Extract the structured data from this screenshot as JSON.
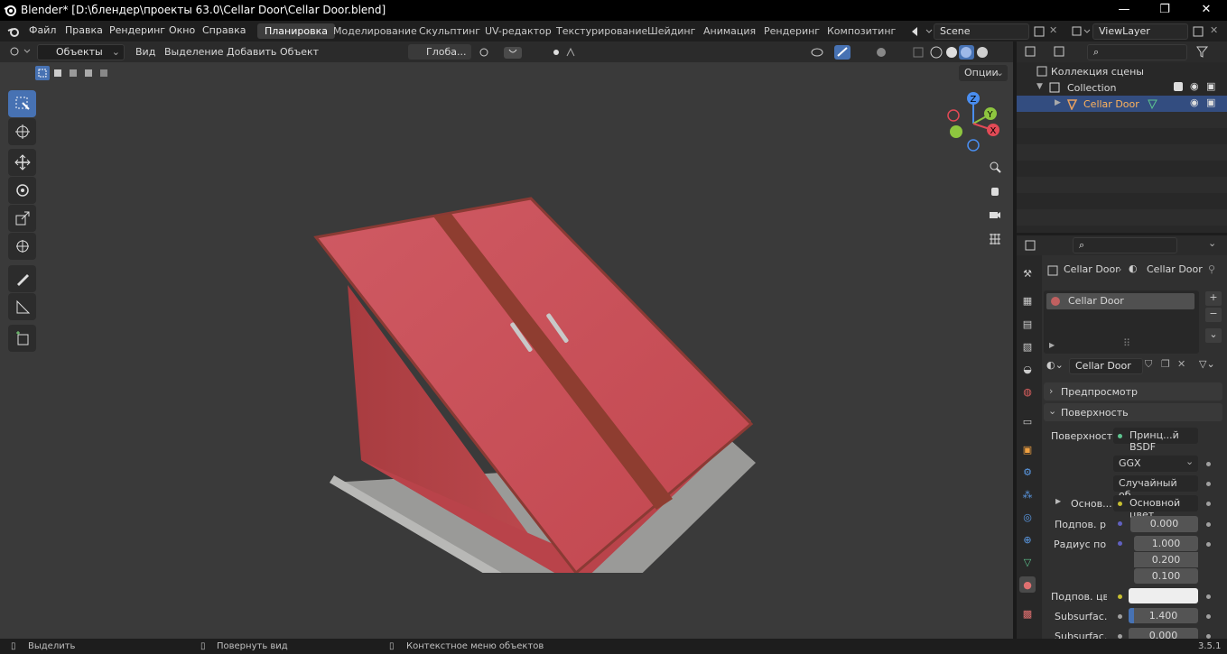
{
  "window": {
    "title": "Blender* [D:\\блендер\\проекты 63.0\\Cellar Door\\Cellar Door.blend]",
    "minimize": "—",
    "maximize": "❐",
    "close": "✕"
  },
  "menu": [
    "Файл",
    "Правка",
    "Рендеринг",
    "Окно",
    "Справка"
  ],
  "workspaces": [
    "Планировка",
    "Моделирование",
    "Скульптинг",
    "UV-редактор",
    "Текстурирование",
    "Шейдинг",
    "Анимация",
    "Рендеринг",
    "Композитинг"
  ],
  "active_workspace": "Планировка",
  "scene": {
    "name": "Scene",
    "view_layer": "ViewLayer"
  },
  "viewport_header": {
    "mode": "Объекты",
    "menus": [
      "Вид",
      "Выделение",
      "Добавить",
      "Объект"
    ],
    "orientation": "Глоба...",
    "options": "Опции"
  },
  "toolbar": [
    "select-box",
    "cursor",
    "move",
    "rotate",
    "scale",
    "transform",
    "annotate",
    "measure",
    "add-cube"
  ],
  "gizmo": {
    "x": "X",
    "y": "Y",
    "z": "Z"
  },
  "outliner": {
    "items": [
      {
        "label": "Коллекция сцены",
        "level": 0
      },
      {
        "label": "Collection",
        "level": 1
      },
      {
        "label": "Cellar Door",
        "level": 2,
        "selected": true
      }
    ]
  },
  "properties": {
    "breadcrumb": [
      "Cellar Door",
      "Cellar Door"
    ],
    "slot": "Cellar Door",
    "material_name": "Cellar Door",
    "panels": {
      "preview": "Предпросмотр",
      "surface": "Поверхность"
    },
    "surface_label": "Поверхность",
    "surface_shader": "Принц...й BSDF",
    "distribution": "GGX",
    "subsurface_method": "Случайный об...",
    "base_label": "Основ...",
    "base_value": "Основной цвет",
    "subsurface_label": "Подпов. р...",
    "subsurface_value": "0.000",
    "radius_label": "Радиус по...",
    "radius_values": [
      "1.000",
      "0.200",
      "0.100"
    ],
    "sub_color_label": "Подпов. цв...",
    "sub_ior_label": "Subsurfac...",
    "sub_ior_value": "1.400",
    "sub_aniso_label": "Subsurfac...",
    "sub_aniso_value": "0.000"
  },
  "status": {
    "select": "Выделить",
    "rotate": "Повернуть вид",
    "context": "Контекстное меню объектов",
    "version": "3.5.1"
  },
  "colors": {
    "accent": "#4772b3",
    "door_red": "#c9525a",
    "selected_row": "#334d80"
  }
}
